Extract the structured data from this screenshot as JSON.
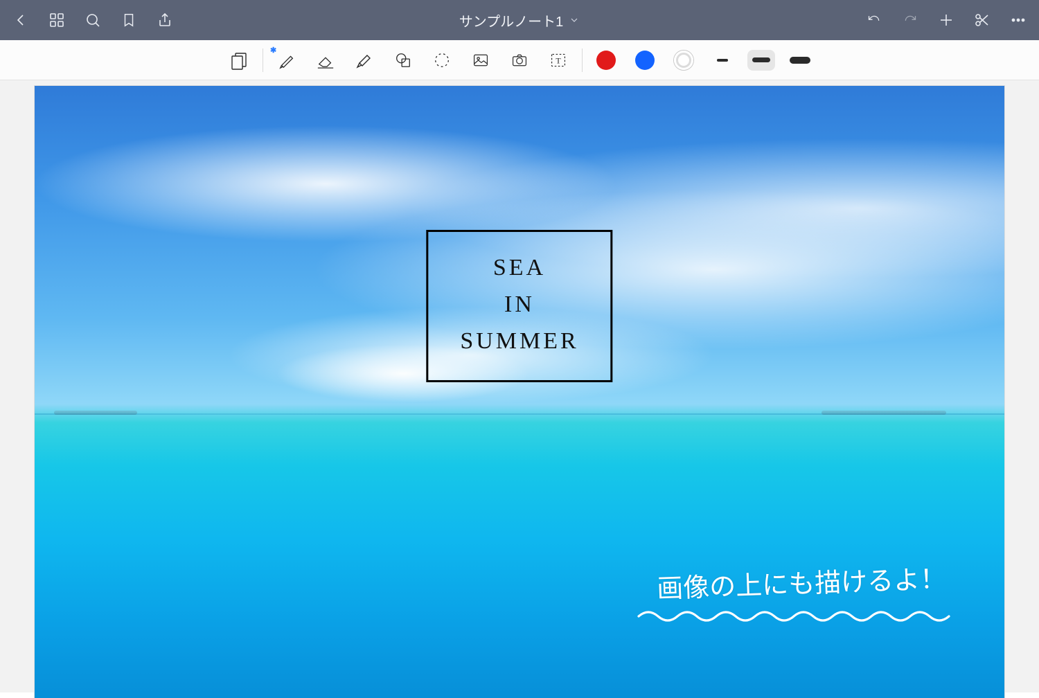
{
  "header": {
    "title": "サンプルノート1"
  },
  "toolbar": {
    "colors": {
      "red": "#e11a1a",
      "blue": "#1363ff"
    },
    "selected_stroke_index": 2
  },
  "canvas": {
    "title_box": {
      "line1": "SEA",
      "line2": "IN",
      "line3": "SUMMER"
    },
    "handwritten_note": "画像の上にも描けるよ！"
  },
  "icons": {
    "back": "back-icon",
    "grid": "grid-icon",
    "search": "search-icon",
    "bookmark": "bookmark-icon",
    "share": "share-icon",
    "undo": "undo-icon",
    "redo": "redo-icon",
    "add": "plus-icon",
    "scissors": "scissors-icon",
    "more": "more-icon",
    "page_template": "page-template-icon",
    "pen": "pen-icon",
    "eraser": "eraser-icon",
    "highlighter": "highlighter-icon",
    "shapes": "shapes-icon",
    "lasso": "lasso-icon",
    "image": "image-icon",
    "camera": "camera-icon",
    "text": "text-icon"
  }
}
